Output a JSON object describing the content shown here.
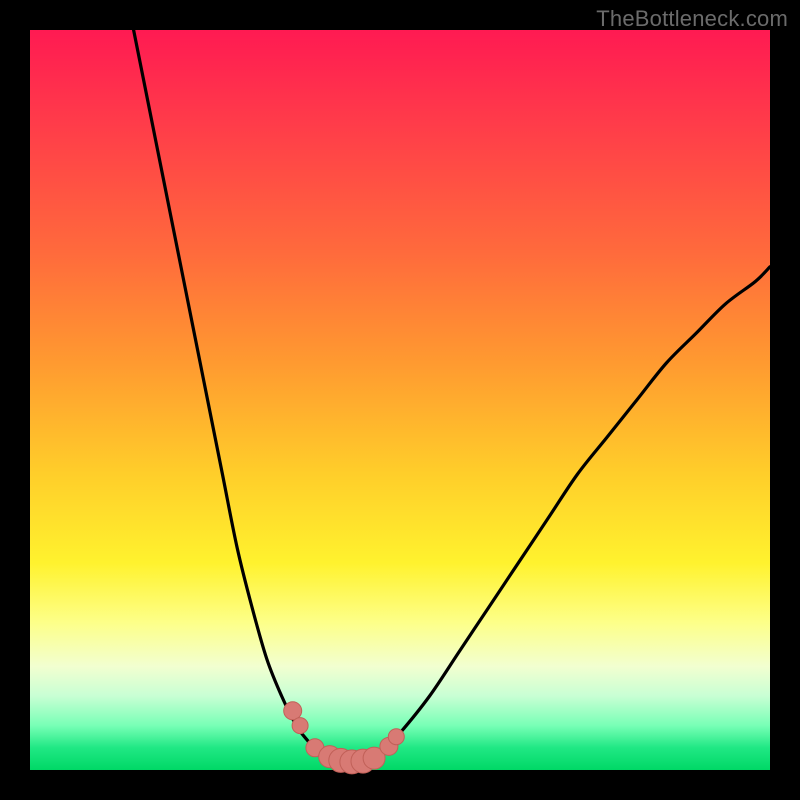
{
  "watermark": {
    "text": "TheBottleneck.com"
  },
  "colors": {
    "frame": "#000000",
    "curve_stroke": "#000000",
    "marker_fill": "#d87a74",
    "marker_stroke": "#c16058",
    "gradient_stops": [
      "#ff1a52",
      "#ff3a4a",
      "#ff6a3c",
      "#ff9a30",
      "#ffce2a",
      "#fff22e",
      "#fdff88",
      "#f2ffd0",
      "#c8ffd4",
      "#78ffb6",
      "#20e884",
      "#00d866"
    ]
  },
  "chart_data": {
    "type": "line",
    "title": "",
    "xlabel": "",
    "ylabel": "",
    "xlim": [
      0,
      100
    ],
    "ylim": [
      0,
      100
    ],
    "grid": false,
    "series": [
      {
        "name": "left-branch",
        "x": [
          14,
          16,
          18,
          20,
          22,
          24,
          26,
          28,
          30,
          32,
          34,
          36,
          37.5,
          39
        ],
        "y": [
          100,
          90,
          80,
          70,
          60,
          50,
          40,
          30,
          22,
          15,
          10,
          6,
          4,
          2.5
        ]
      },
      {
        "name": "trough",
        "x": [
          39,
          40,
          41,
          42,
          43,
          44,
          45,
          46,
          47,
          48
        ],
        "y": [
          2.5,
          1.8,
          1.4,
          1.2,
          1.1,
          1.1,
          1.2,
          1.5,
          2.0,
          3.0
        ]
      },
      {
        "name": "right-branch",
        "x": [
          48,
          50,
          54,
          58,
          62,
          66,
          70,
          74,
          78,
          82,
          86,
          90,
          94,
          98,
          100
        ],
        "y": [
          3,
          5,
          10,
          16,
          22,
          28,
          34,
          40,
          45,
          50,
          55,
          59,
          63,
          66,
          68
        ]
      }
    ],
    "markers": {
      "name": "highlight-dots",
      "x": [
        35.5,
        36.5,
        38.5,
        40.5,
        42.0,
        43.5,
        45.0,
        46.5,
        48.5,
        49.5
      ],
      "y": [
        8.0,
        6.0,
        3.0,
        1.8,
        1.3,
        1.1,
        1.2,
        1.6,
        3.2,
        4.5
      ],
      "r": [
        9,
        8,
        9,
        11,
        12,
        12,
        12,
        11,
        9,
        8
      ]
    }
  }
}
